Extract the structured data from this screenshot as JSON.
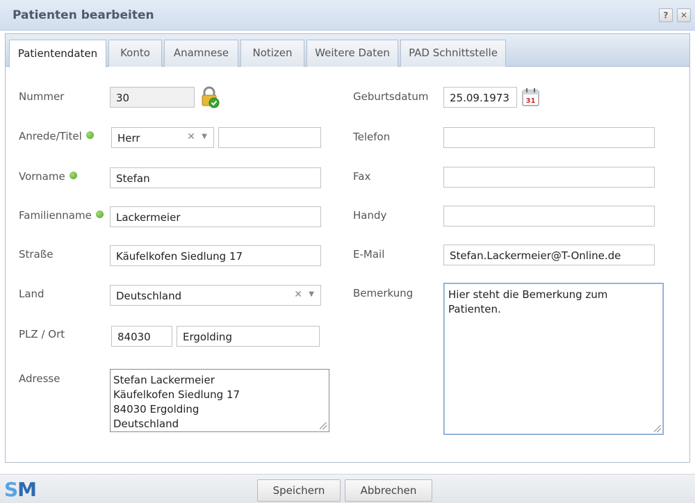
{
  "window": {
    "title": "Patienten bearbeiten",
    "help_label": "?",
    "close_label": "✕"
  },
  "tabs": [
    {
      "label": "Patientendaten",
      "active": true
    },
    {
      "label": "Konto"
    },
    {
      "label": "Anamnese"
    },
    {
      "label": "Notizen"
    },
    {
      "label": "Weitere Daten"
    },
    {
      "label": "PAD Schnittstelle"
    }
  ],
  "form": {
    "nummer": {
      "label": "Nummer",
      "value": "30"
    },
    "anrede": {
      "label": "Anrede/Titel",
      "value": "Herr",
      "titel_value": ""
    },
    "vorname": {
      "label": "Vorname",
      "value": "Stefan"
    },
    "familienname": {
      "label": "Familienname",
      "value": "Lackermeier"
    },
    "strasse": {
      "label": "Straße",
      "value": "Käufelkofen Siedlung 17"
    },
    "land": {
      "label": "Land",
      "value": "Deutschland"
    },
    "plz_ort": {
      "label": "PLZ / Ort",
      "plz": "84030",
      "ort": "Ergolding"
    },
    "adresse": {
      "label": "Adresse",
      "lines": [
        "Stefan Lackermeier",
        "Käufelkofen Siedlung 17",
        "84030 Ergolding",
        "Deutschland"
      ]
    },
    "geburtsdatum": {
      "label": "Geburtsdatum",
      "value": "25.09.1973",
      "calendar_day": "31"
    },
    "telefon": {
      "label": "Telefon",
      "value": ""
    },
    "fax": {
      "label": "Fax",
      "value": ""
    },
    "handy": {
      "label": "Handy",
      "value": ""
    },
    "email": {
      "label": "E-Mail",
      "value": "Stefan.Lackermeier@T-Online.de"
    },
    "bemerkung": {
      "label": "Bemerkung",
      "value": "Hier steht die Bemerkung zum Patienten."
    }
  },
  "combo_icons": {
    "clear": "✕",
    "arrow": "▼"
  },
  "icons": {
    "lock": "lock-check-icon",
    "calendar": "calendar-icon",
    "required": "required-dot-icon"
  },
  "colors": {
    "required": "#52a228",
    "accent": "#2d6bb2"
  },
  "footer": {
    "logo": {
      "s": "S",
      "m": "M"
    },
    "save_label": "Speichern",
    "cancel_label": "Abbrechen"
  }
}
